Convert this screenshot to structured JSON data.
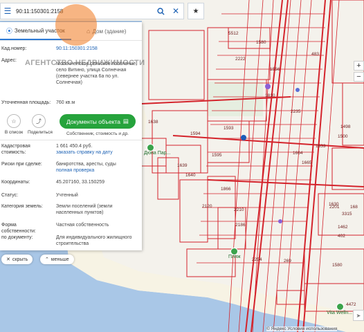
{
  "search": {
    "value": "90:11:150301:2158"
  },
  "tabs": [
    {
      "label": "Земельный участок"
    },
    {
      "label": "Дом (здание)"
    }
  ],
  "panel": {
    "cadastral_label": "Кад.номер:",
    "cadastral_value": "90:11:150301:2158",
    "address_label": "Адрес:",
    "address_value": "Молочненское сельское поселение, село Витино, улица Солнечная (севернее участка 6а по ул. Солнечная)",
    "area_label": "Уточненная площадь:",
    "area_value": "760 кв.м",
    "cost_label": "Кадастровая стоимость:",
    "cost_value": "1 661 450.4 руб.",
    "cost_link": "заказать справку на дату",
    "risks_label": "Риски при сделке:",
    "risks_value": "банкротства, аресты, суды",
    "risks_link": "полная проверка",
    "coords_label": "Координаты:",
    "coords_value": "45.207160, 33.150259",
    "status_label": "Статус:",
    "status_value": "Учтенный",
    "category_label": "Категория земель:",
    "category_value": "Земли поселений (земли населенных пунктов)",
    "ownership_label": "Форма собственности:",
    "ownership_value": "Частная собственность",
    "use_label": "по документу:",
    "use_value": "Для индивидуального жилищного строительства"
  },
  "actions": {
    "add_to_list": "В список",
    "share": "Поделиться",
    "docs_button": "Документы объекта",
    "docs_sub": "Собственник, стоимость и др."
  },
  "pills": {
    "hide": "скрыть",
    "less": "меньше"
  },
  "watermark": {
    "text": "АГЕНТСТВО НЕДВИЖИМОСТИ"
  },
  "map": {
    "pois": [
      "Дюна Пар...",
      "Пляж",
      "Vita Welln..."
    ],
    "parcels": [
      "5512",
      "1580",
      "2222",
      "1593",
      "1594",
      "1595",
      "1638",
      "1639",
      "1640",
      "2120",
      "2254",
      "269",
      "1580",
      "2201",
      "1630",
      "168",
      "3315",
      "1462",
      "402",
      "1498",
      "4472",
      "1556",
      "483",
      "1810",
      "2235",
      "2210",
      "2186",
      "1866",
      "1664",
      "1665",
      "1633",
      "1500"
    ]
  },
  "attribution": "© Яндекс Условия использования"
}
